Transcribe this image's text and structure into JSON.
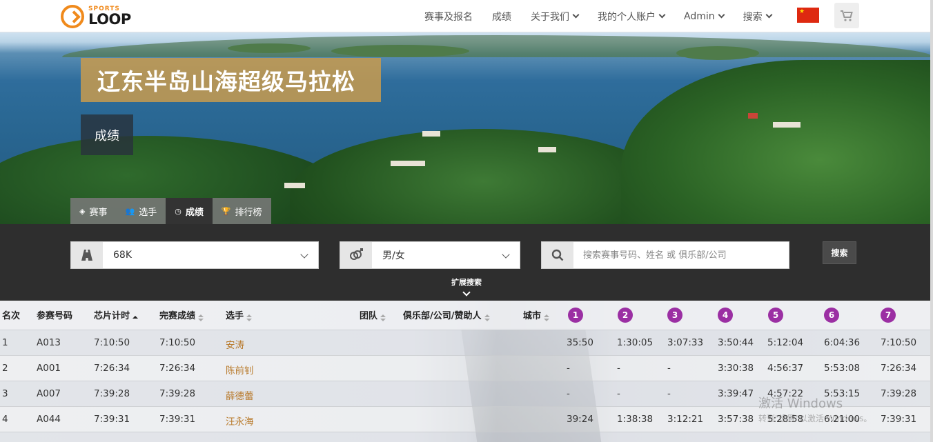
{
  "nav": {
    "logo_small": "SPORTS",
    "logo_big": "LOOP",
    "items": [
      {
        "label": "赛事及报名",
        "dropdown": false
      },
      {
        "label": "成绩",
        "dropdown": false
      },
      {
        "label": "关于我们",
        "dropdown": true
      },
      {
        "label": "我的个人账户",
        "dropdown": true
      },
      {
        "label": "Admin",
        "dropdown": true
      },
      {
        "label": "搜索",
        "dropdown": true
      }
    ],
    "flag_icon": "china-flag-icon",
    "cart_icon": "cart-icon"
  },
  "hero": {
    "title": "辽东半岛山海超级马拉松",
    "subtitle": "成绩",
    "tabs": [
      {
        "label": "赛事",
        "icon": "tag-icon",
        "active": false
      },
      {
        "label": "选手",
        "icon": "users-icon",
        "active": false
      },
      {
        "label": "成绩",
        "icon": "clock-icon",
        "active": true
      },
      {
        "label": "排行榜",
        "icon": "trophy-icon",
        "active": false
      }
    ]
  },
  "filters": {
    "race": {
      "value": "68K",
      "icon": "road-icon"
    },
    "gender": {
      "value": "男/女",
      "icon": "gender-icon"
    },
    "search": {
      "placeholder": "搜索赛事号码、姓名 或 俱乐部/公司",
      "value": "",
      "icon": "search-icon"
    },
    "search_button": "搜索",
    "expand_label": "扩展搜索"
  },
  "table": {
    "headers": {
      "rank": "名次",
      "bib": "参赛号码",
      "chip": "芯片计时",
      "gun": "完赛成绩",
      "athlete": "选手",
      "team": "团队",
      "club": "俱乐部/公司/赞助人",
      "city": "城市"
    },
    "splits": [
      "1",
      "2",
      "3",
      "4",
      "5",
      "6",
      "7"
    ],
    "rows": [
      {
        "rank": "1",
        "bib": "A013",
        "chip": "7:10:50",
        "gun": "7:10:50",
        "name": "安涛",
        "s": [
          "35:50",
          "1:30:05",
          "3:07:33",
          "3:50:44",
          "5:12:04",
          "6:04:36",
          "7:10:50"
        ]
      },
      {
        "rank": "2",
        "bib": "A001",
        "chip": "7:26:34",
        "gun": "7:26:34",
        "name": "陈前钊",
        "s": [
          "-",
          "-",
          "-",
          "3:30:38",
          "4:56:37",
          "5:53:08",
          "7:26:34"
        ]
      },
      {
        "rank": "3",
        "bib": "A007",
        "chip": "7:39:28",
        "gun": "7:39:28",
        "name": "薛德蕾",
        "s": [
          "-",
          "-",
          "-",
          "3:39:47",
          "4:57:22",
          "5:53:15",
          "7:39:28"
        ]
      },
      {
        "rank": "4",
        "bib": "A044",
        "chip": "7:39:31",
        "gun": "7:39:31",
        "name": "汪永海",
        "s": [
          "39:24",
          "1:38:38",
          "3:12:21",
          "3:57:38",
          "5:28:58",
          "6:21:00",
          "7:39:31"
        ]
      }
    ]
  },
  "watermark": {
    "line1": "激活 Windows",
    "line2": "转到\"设置\"以激活 Windows。"
  },
  "colors": {
    "accent_gold": "#c49a50",
    "split_purple": "#9b2fa3",
    "name_link": "#b8792a",
    "filter_bar": "#2e2e2e"
  }
}
